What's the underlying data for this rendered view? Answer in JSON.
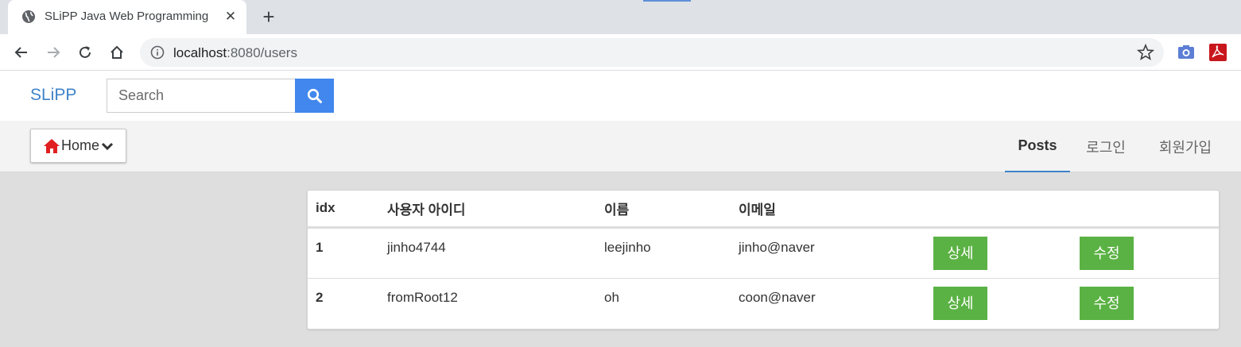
{
  "browser": {
    "tab_title": "SLiPP Java Web Programming",
    "url_host": "localhost",
    "url_rest": ":8080/users"
  },
  "header": {
    "brand": "SLiPP",
    "search_placeholder": "Search"
  },
  "navbar": {
    "home_label": "Home",
    "items": [
      {
        "label": "Posts",
        "active": true
      },
      {
        "label": "로그인",
        "active": false
      },
      {
        "label": "회원가입",
        "active": false
      }
    ]
  },
  "users_table": {
    "columns": [
      "idx",
      "사용자 아이디",
      "이름",
      "이메일"
    ],
    "rows": [
      {
        "idx": "1",
        "user_id": "jinho4744",
        "name": "leejinho",
        "email": "jinho@naver",
        "detail_label": "상세",
        "edit_label": "수정"
      },
      {
        "idx": "2",
        "user_id": "fromRoot12",
        "name": "oh",
        "email": "coon@naver",
        "detail_label": "상세",
        "edit_label": "수정"
      }
    ]
  },
  "colors": {
    "brand": "#3f83c8",
    "search_button": "#4187ed",
    "action_button": "#5bb244",
    "home_icon": "#e02020"
  },
  "icons": [
    "globe-icon",
    "close-icon",
    "plus-icon",
    "back-icon",
    "forward-icon",
    "reload-icon",
    "home-icon",
    "info-icon",
    "star-icon",
    "camera-icon",
    "pdf-icon",
    "search-icon",
    "chevron-down-icon"
  ]
}
